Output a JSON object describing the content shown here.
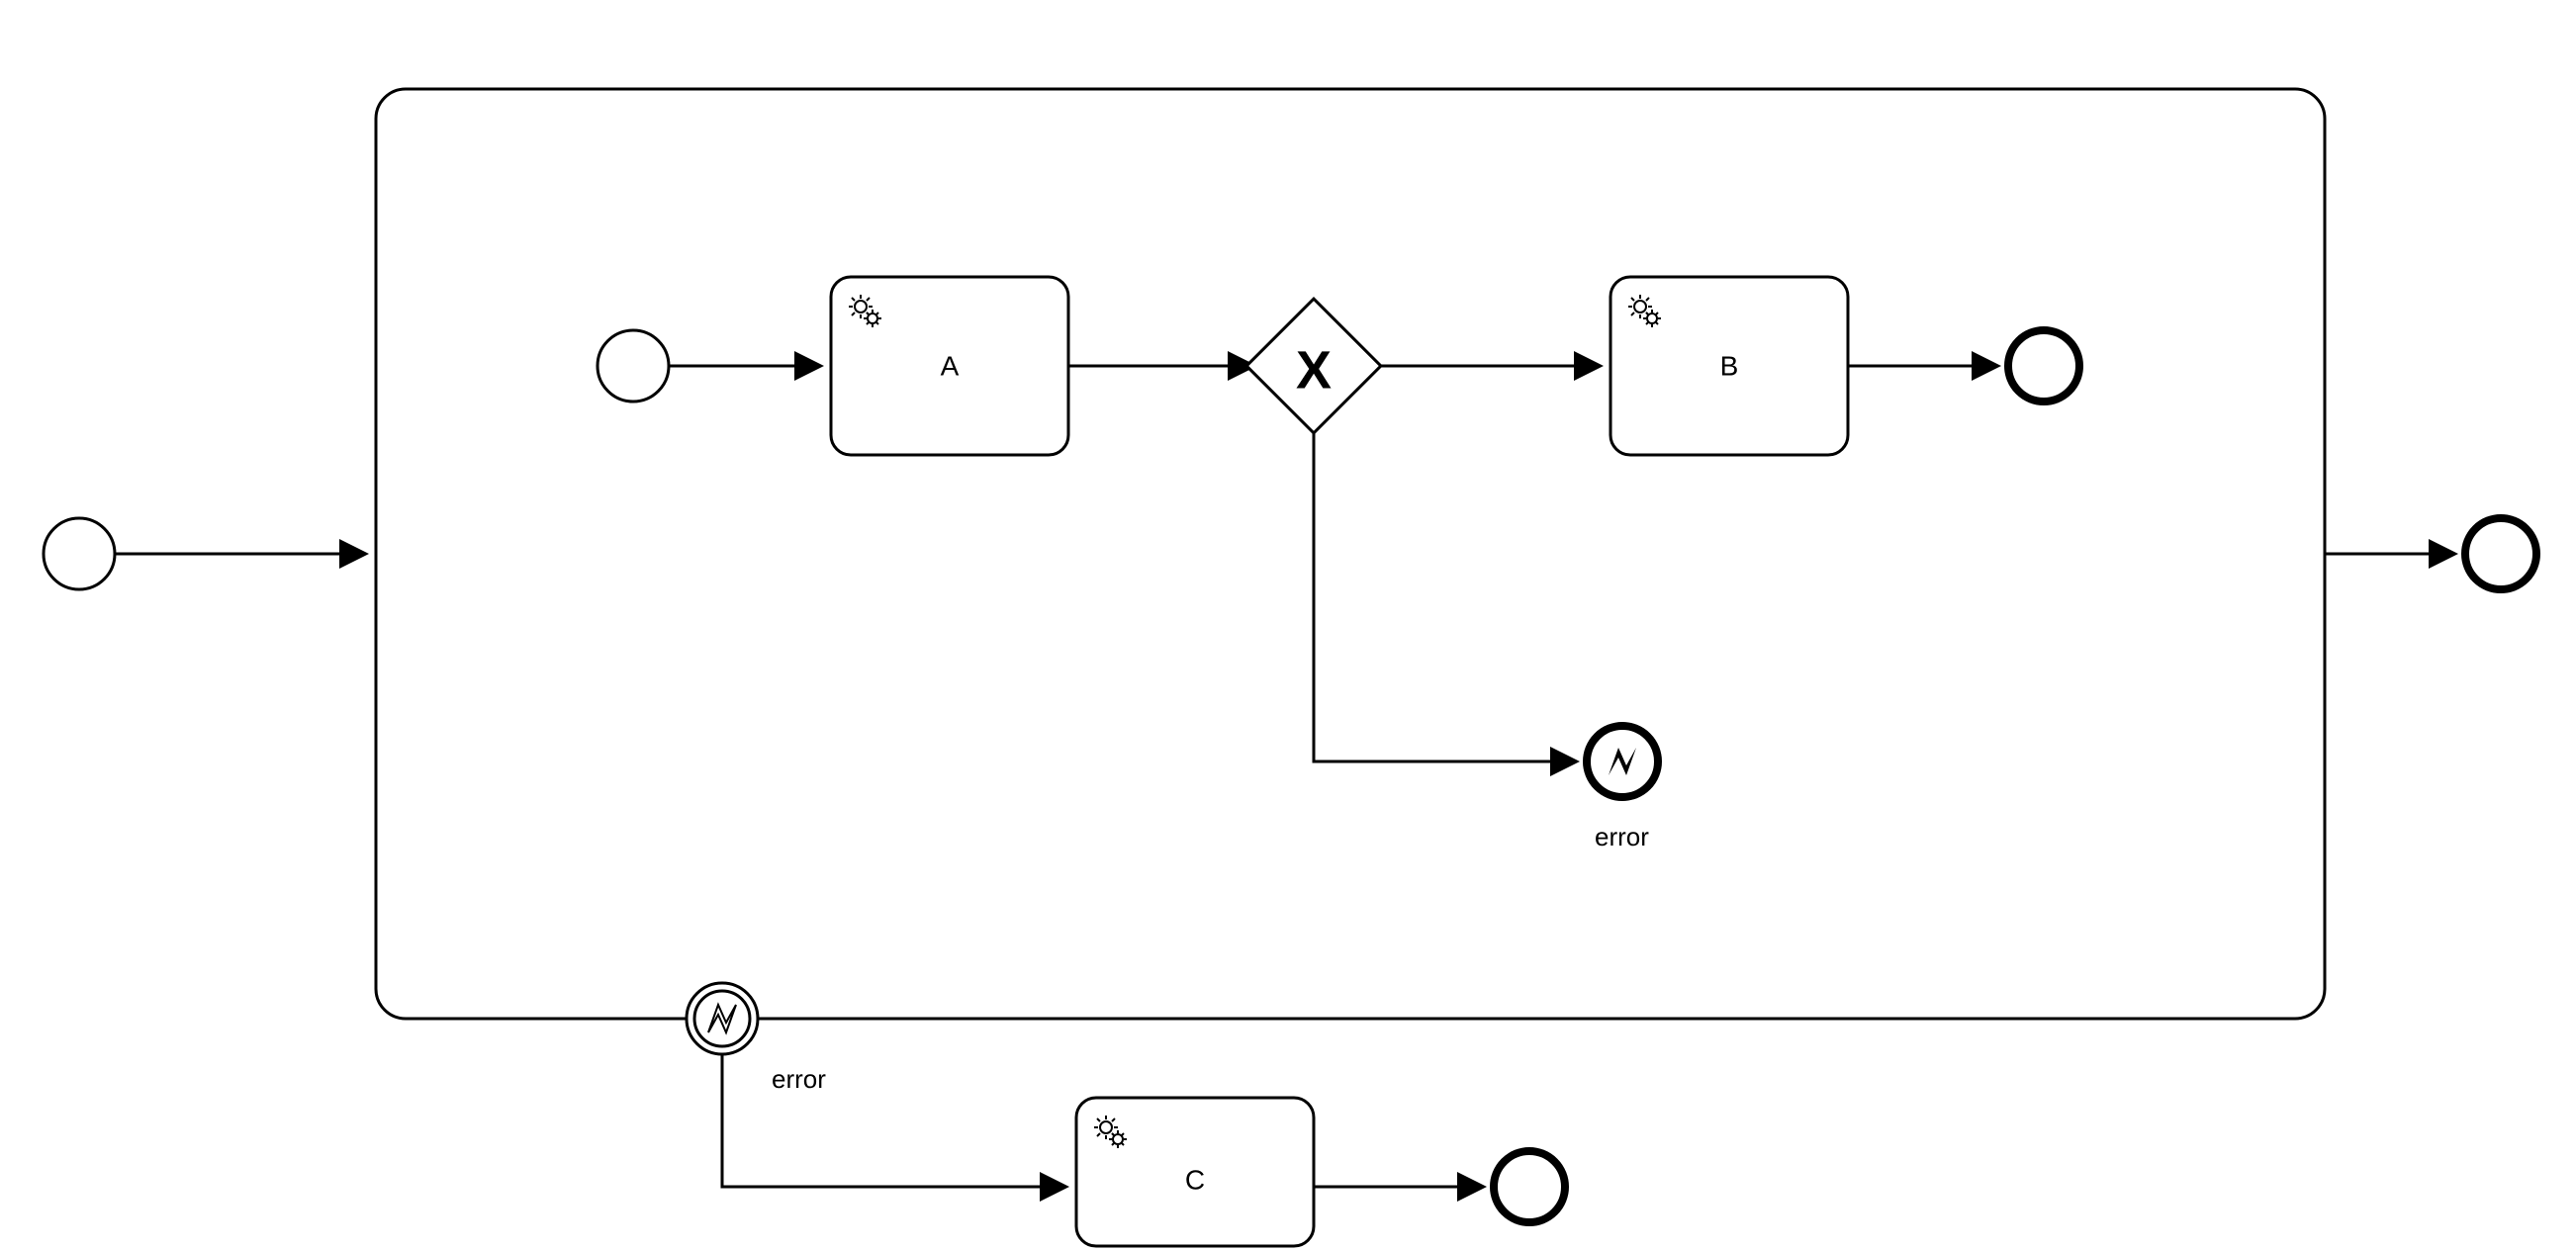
{
  "tasks": {
    "a": {
      "label": "A"
    },
    "b": {
      "label": "B"
    },
    "c": {
      "label": "C"
    }
  },
  "events": {
    "error_end": {
      "label": "error"
    },
    "boundary_error": {
      "label": "error"
    }
  }
}
